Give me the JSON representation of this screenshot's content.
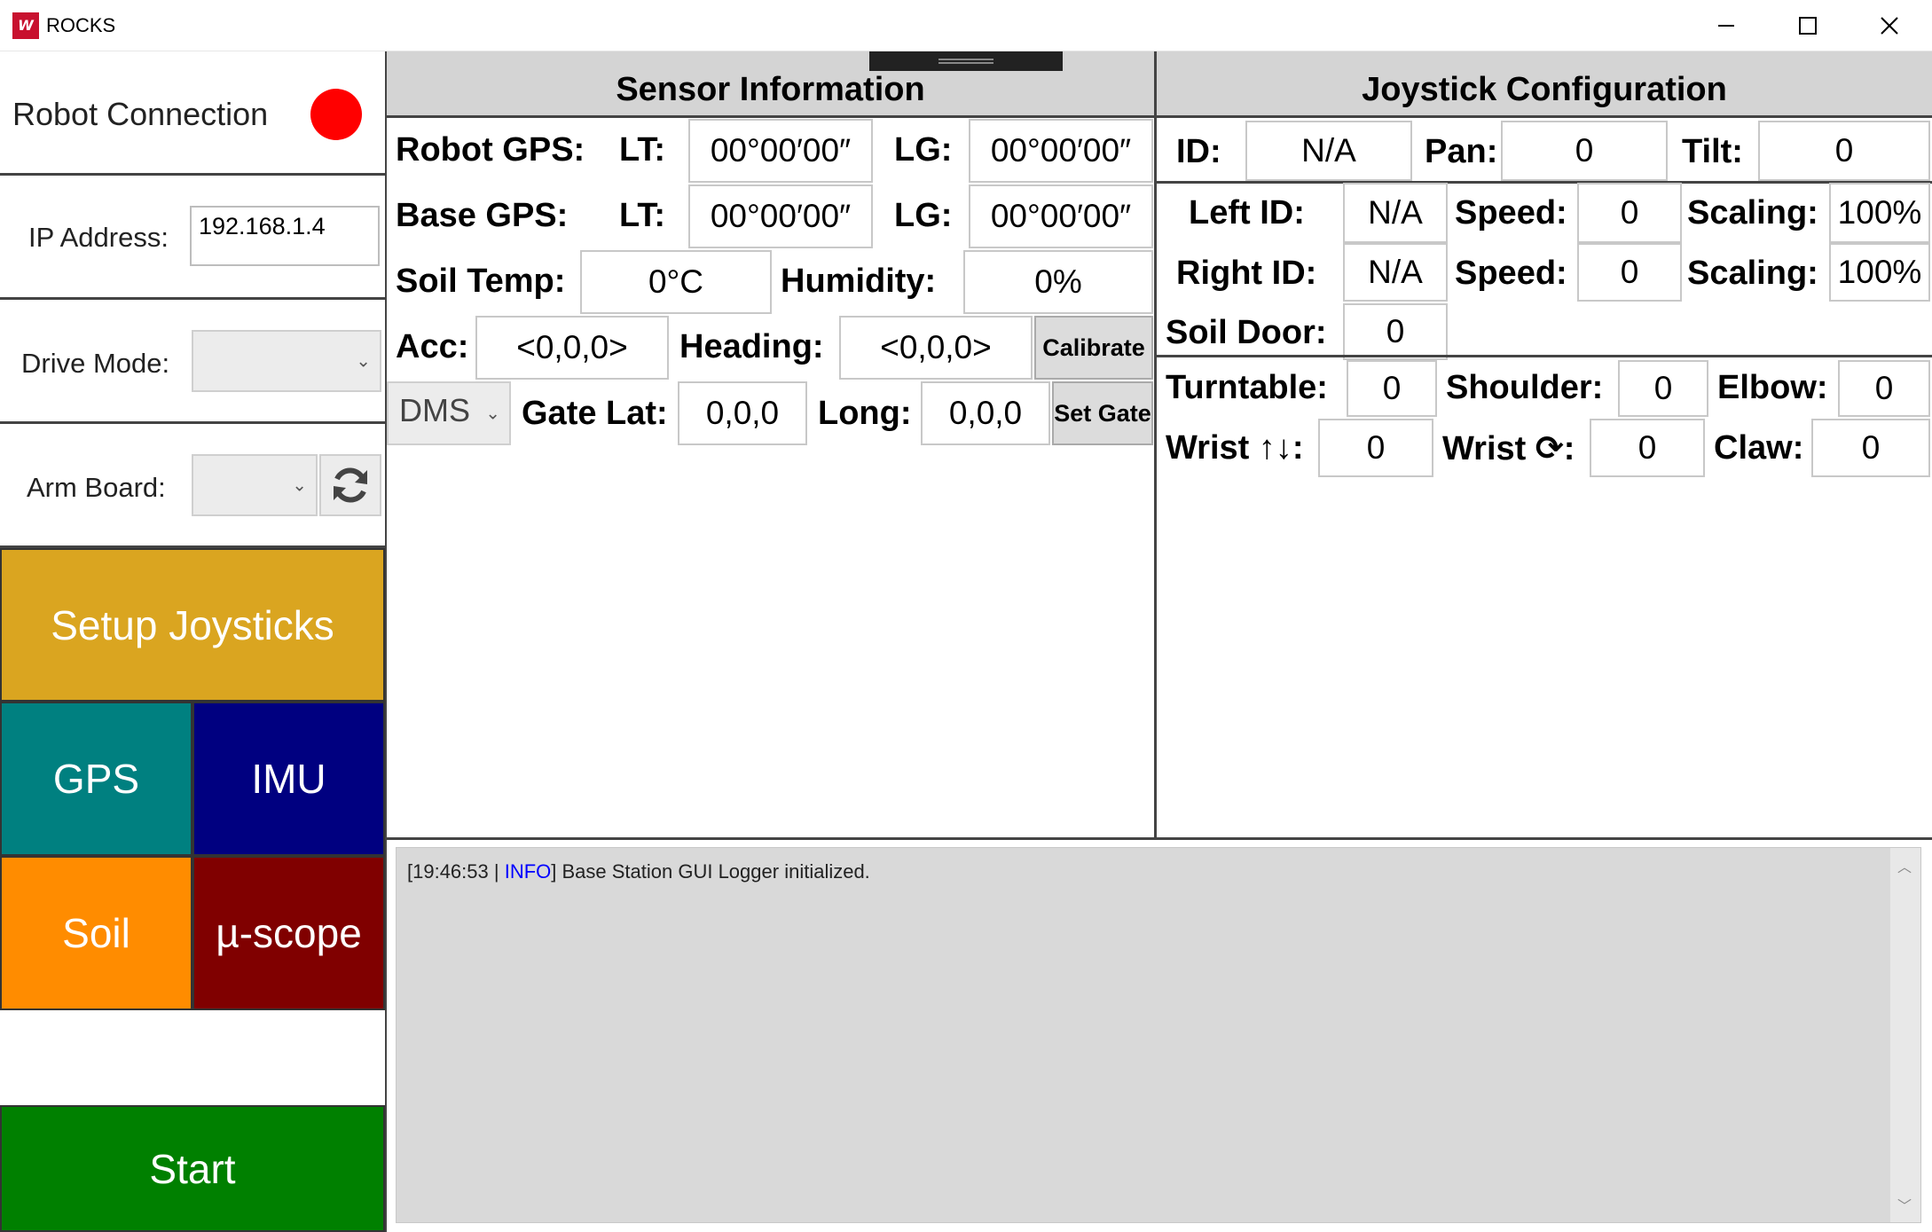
{
  "window": {
    "title": "ROCKS"
  },
  "left": {
    "robot_connection": "Robot Connection",
    "status_color": "#ff0000",
    "ip_label": "IP Address:",
    "ip_value": "192.168.1.4",
    "drive_label": "Drive Mode:",
    "drive_value": "",
    "arm_label": "Arm Board:",
    "arm_value": "",
    "setup": "Setup Joysticks",
    "gps": "GPS",
    "imu": "IMU",
    "soil": "Soil",
    "microscope": "µ-scope",
    "start": "Start"
  },
  "sensor": {
    "title": "Sensor Information",
    "robot_gps": "Robot GPS:",
    "base_gps": "Base GPS:",
    "lt": "LT:",
    "lg": "LG:",
    "robot_lt": "00°00′00″",
    "robot_lg": "00°00′00″",
    "base_lt": "00°00′00″",
    "base_lg": "00°00′00″",
    "soil_temp_label": "Soil Temp:",
    "soil_temp": "0°C",
    "humidity_label": "Humidity:",
    "humidity": "0%",
    "acc_label": "Acc:",
    "acc": "<0,0,0>",
    "heading_label": "Heading:",
    "heading": "<0,0,0>",
    "calibrate": "Calibrate",
    "format": "DMS",
    "gate_lat_label": "Gate Lat:",
    "gate_lat": "0,0,0",
    "long_label": "Long:",
    "gate_long": "0,0,0",
    "set_gate": "Set Gate"
  },
  "joystick": {
    "title": "Joystick Configuration",
    "id_label": "ID:",
    "id": "N/A",
    "pan_label": "Pan:",
    "pan": "0",
    "tilt_label": "Tilt:",
    "tilt": "0",
    "left_id_label": "Left ID:",
    "left_id": "N/A",
    "speed_label": "Speed:",
    "left_speed": "0",
    "scaling_label": "Scaling:",
    "left_scaling": "100%",
    "right_id_label": "Right ID:",
    "right_id": "N/A",
    "right_speed": "0",
    "right_scaling": "100%",
    "soil_door_label": "Soil Door:",
    "soil_door": "0",
    "turntable_label": "Turntable:",
    "turntable": "0",
    "shoulder_label": "Shoulder:",
    "shoulder": "0",
    "elbow_label": "Elbow:",
    "elbow": "0",
    "wrist_ud_label": "Wrist ↑↓:",
    "wrist_ud": "0",
    "wrist_rot_label": "Wrist ⟳:",
    "wrist_rot": "0",
    "claw_label": "Claw:",
    "claw": "0"
  },
  "log": {
    "time": "[19:46:53 | ",
    "level": "INFO",
    "message": "] Base Station GUI Logger initialized.",
    "level_color": "#0000ff"
  }
}
